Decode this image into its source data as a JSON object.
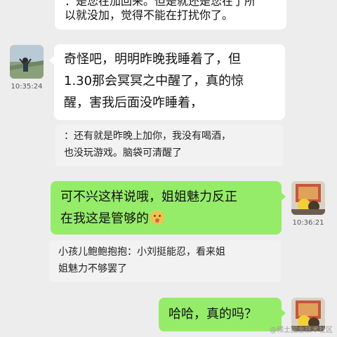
{
  "messages": [
    {
      "text_line1": "：是您在加回来。但是就还是您在了所",
      "text_line2": "以就没加，觉得不能在打扰你了。"
    },
    {
      "time": "10:35:24",
      "text_line1": "奇怪吧，明明昨晚我睡着了，但",
      "text_line2": "1.30那会冥冥之中醒了，真的惊",
      "text_line3": "醒，害我后面没咋睡着，",
      "quote_line1": "：还有就是昨晚上加你，我没有喝酒，",
      "quote_line2": "也没玩游戏。脑袋可清醒了"
    },
    {
      "time": "10:36:21",
      "text_line1": "可不兴这样说哦，姐姐魅力反正",
      "text_line2": "在我这是管够的",
      "quote_line1": "小孩儿鲍鲍抱抱：小刘挺能忍，看来姐",
      "quote_line2": "姐魅力不够罢了"
    },
    {
      "text": "哈哈，真的吗？"
    }
  ],
  "watermark": "@稀土掘金技术社区",
  "colors": {
    "background": "#ededed",
    "self_bubble": "#95ec69",
    "other_bubble": "#ffffff"
  }
}
